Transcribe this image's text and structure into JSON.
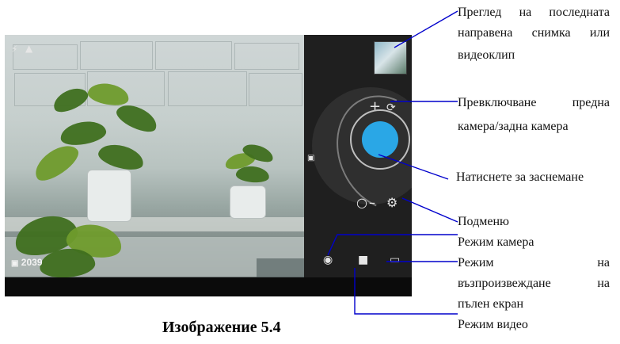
{
  "status_overlay": {
    "remaining_shots": "2039"
  },
  "annotations": {
    "preview": {
      "line1": "Преглед на последната",
      "line2": "направена снимка или",
      "line3": "видеоклип"
    },
    "switch_camera": {
      "line1": "Превключване предна",
      "line2": "камера/задна камера"
    },
    "shutter": {
      "text": "Натиснете за заснемане"
    },
    "submenu": {
      "text": "Подменю"
    },
    "camera_mode": {
      "text": "Режим камера"
    },
    "panorama_mode": {
      "line1": "Режим на",
      "line2": "възпроизвеждане на",
      "line3": "пълен екран"
    },
    "video_mode": {
      "text": "Режим видео"
    }
  },
  "caption": "Изображение 5.4",
  "colors": {
    "accent": "#2aa7e6",
    "line": "#0000cc",
    "panel_bg": "#1f1f1f",
    "dial_bg": "#2f2f2f"
  },
  "icons": {
    "top_left_status": [
      "flash-auto-icon",
      "scene-mode-icon"
    ],
    "panel": [
      "zoom-plus-icon",
      "switch-camera-icon",
      "zoom-minus-icon",
      "settings-sliders-icon",
      "camera-mode-icon",
      "video-mode-icon",
      "panorama-mode-icon",
      "gallery-small-icon"
    ]
  }
}
